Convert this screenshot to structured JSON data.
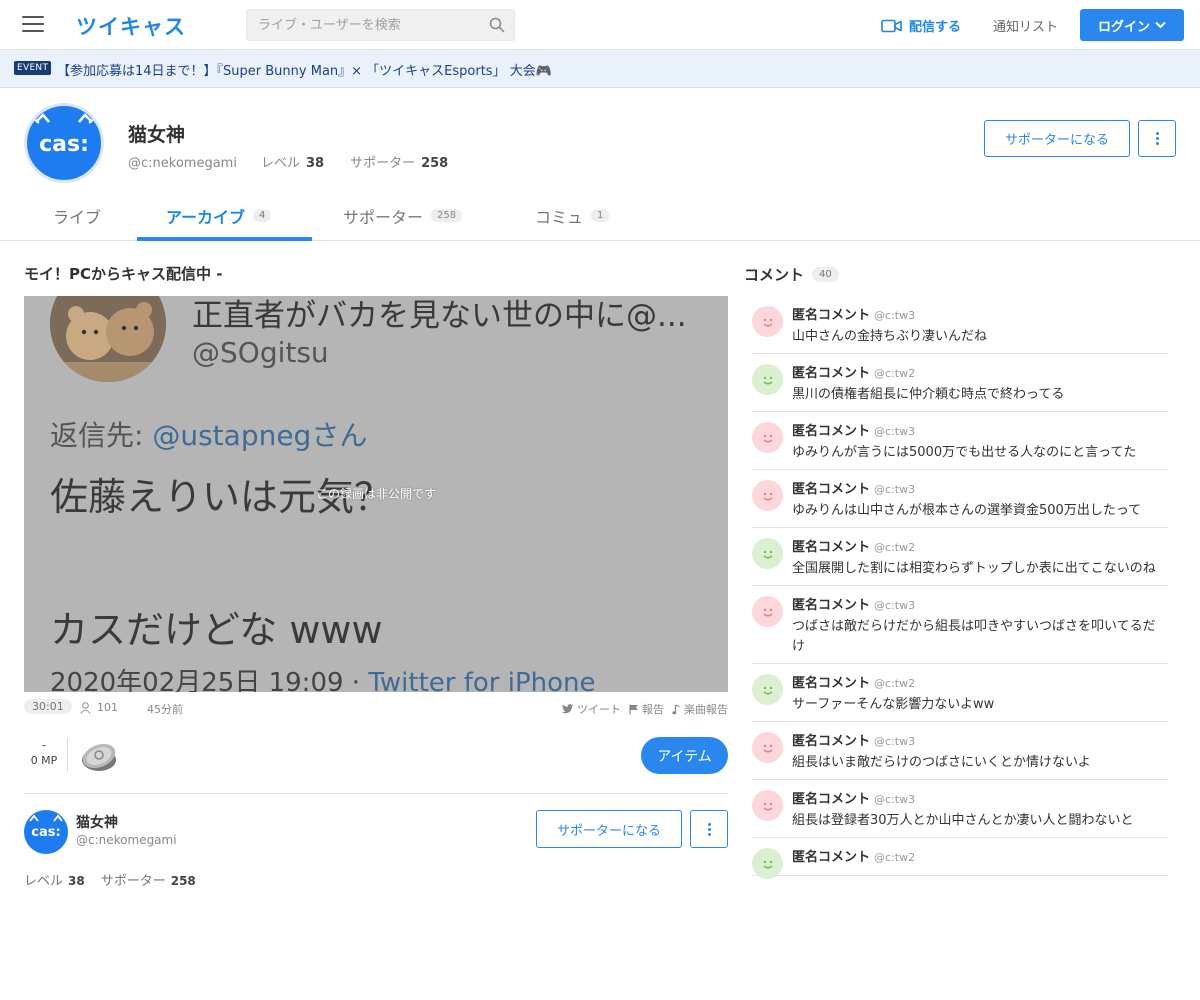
{
  "header": {
    "logo": "ツイキャス",
    "search_placeholder": "ライブ・ユーザーを検索",
    "broadcast": "配信する",
    "notifications": "通知リスト",
    "login": "ログイン"
  },
  "event": {
    "badge": "EVENT",
    "text": "【参加応募は14日まで！】『Super Bunny Man』× 「ツイキャスEsports」 大会🎮"
  },
  "profile": {
    "avatar_text": "cas:",
    "name": "猫女神",
    "user_id": "@c:nekomegami",
    "level_label": "レベル",
    "level": "38",
    "supporters_label": "サポーター",
    "supporters": "258",
    "become_supporter": "サポーターになる"
  },
  "tabs": [
    {
      "label": "ライブ",
      "count": ""
    },
    {
      "label": "アーカイブ",
      "count": "4"
    },
    {
      "label": "サポーター",
      "count": "258"
    },
    {
      "label": "コミュ",
      "count": "1"
    }
  ],
  "movie": {
    "title": "モイ！PCからキャス配信中 -",
    "thumb_lines": {
      "line1": "正直者がバカを見ない世の中に@...",
      "line2": "@SOgitsu",
      "line3_prefix": "返信先: ",
      "line3_mention": "@ustapnegさん",
      "line4": "佐藤えりいは元気？",
      "line5": "カスだけどな www",
      "line6_date": "2020年02月25日 19:09 · ",
      "line6_src": "Twitter for iPhone"
    },
    "overlay": "この録画は非公開です",
    "duration": "30:01",
    "viewers": "101",
    "ago": "45分前",
    "tweet": "ツイート",
    "report": "報告",
    "music_report": "楽曲報告",
    "mp_dash": "-",
    "mp": "0 MP",
    "item_button": "アイテム"
  },
  "comments_header": {
    "label": "コメント",
    "count": "40"
  },
  "comments": [
    {
      "name": "匿名コメント",
      "id": "@c:tw3",
      "text": "山中さんの金持ちぶり凄いんだね",
      "color": "pink"
    },
    {
      "name": "匿名コメント",
      "id": "@c:tw2",
      "text": "黒川の債権者組長に仲介頼む時点で終わってる",
      "color": "green"
    },
    {
      "name": "匿名コメント",
      "id": "@c:tw3",
      "text": "ゆみりんが言うには5000万でも出せる人なのにと言ってた",
      "color": "pink"
    },
    {
      "name": "匿名コメント",
      "id": "@c:tw3",
      "text": "ゆみりんは山中さんが根本さんの選挙資金500万出したって",
      "color": "pink"
    },
    {
      "name": "匿名コメント",
      "id": "@c:tw2",
      "text": "全国展開した割には相変わらずトップしか表に出てこないのね",
      "color": "green"
    },
    {
      "name": "匿名コメント",
      "id": "@c:tw3",
      "text": "つばさは敵だらけだから組長は叩きやすいつばさを叩いてるだけ",
      "color": "pink"
    },
    {
      "name": "匿名コメント",
      "id": "@c:tw2",
      "text": "サーファーそんな影響力ないよww",
      "color": "green"
    },
    {
      "name": "匿名コメント",
      "id": "@c:tw3",
      "text": "組長はいま敵だらけのつばさにいくとか情けないよ",
      "color": "pink"
    },
    {
      "name": "匿名コメント",
      "id": "@c:tw3",
      "text": "組長は登録者30万人とか山中さんとか凄い人と闘わないと",
      "color": "pink"
    },
    {
      "name": "匿名コメント",
      "id": "@c:tw2",
      "text": "",
      "color": "green"
    }
  ],
  "colors": {
    "accent": "#2a87ee",
    "brand": "#1e88e5"
  }
}
